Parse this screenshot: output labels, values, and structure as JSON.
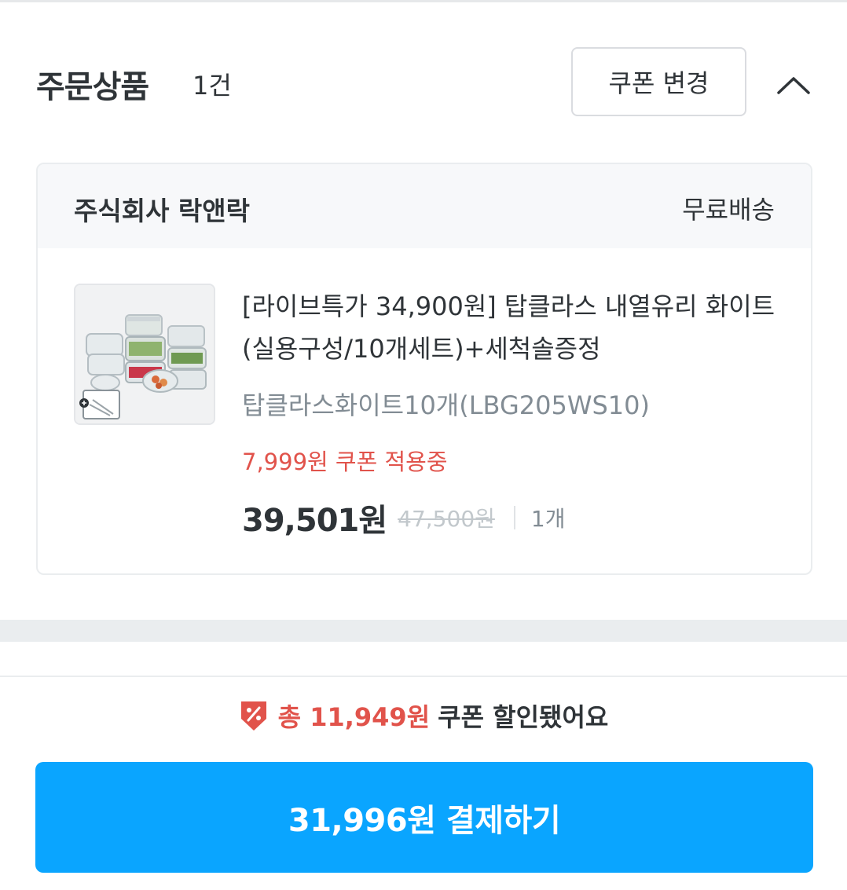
{
  "header": {
    "title": "주문상품",
    "count": "1건",
    "coupon_change_label": "쿠폰 변경"
  },
  "seller": {
    "name": "주식회사 락앤락",
    "shipping": "무료배송"
  },
  "product": {
    "name": "[라이브특가 34,900원] 탑클라스 내열유리 화이트 (실용구성/10개세트)+세척솔증정",
    "option": "탑클라스화이트10개(LBG205WS10)",
    "coupon_applied": "7,999원 쿠폰 적용중",
    "price": "39,501원",
    "original_price": "47,500원",
    "quantity": "1개",
    "thumbnail_icon": "glass-containers-image"
  },
  "discount": {
    "highlight": "총 11,949원",
    "rest": "쿠폰 할인됐어요",
    "icon": "coupon-tag-icon"
  },
  "pay_button": {
    "label": "31,996원 결제하기"
  },
  "colors": {
    "accent": "#0aa5ff",
    "discount_red": "#e1534b",
    "text": "#2f3438",
    "muted": "#828c94"
  }
}
